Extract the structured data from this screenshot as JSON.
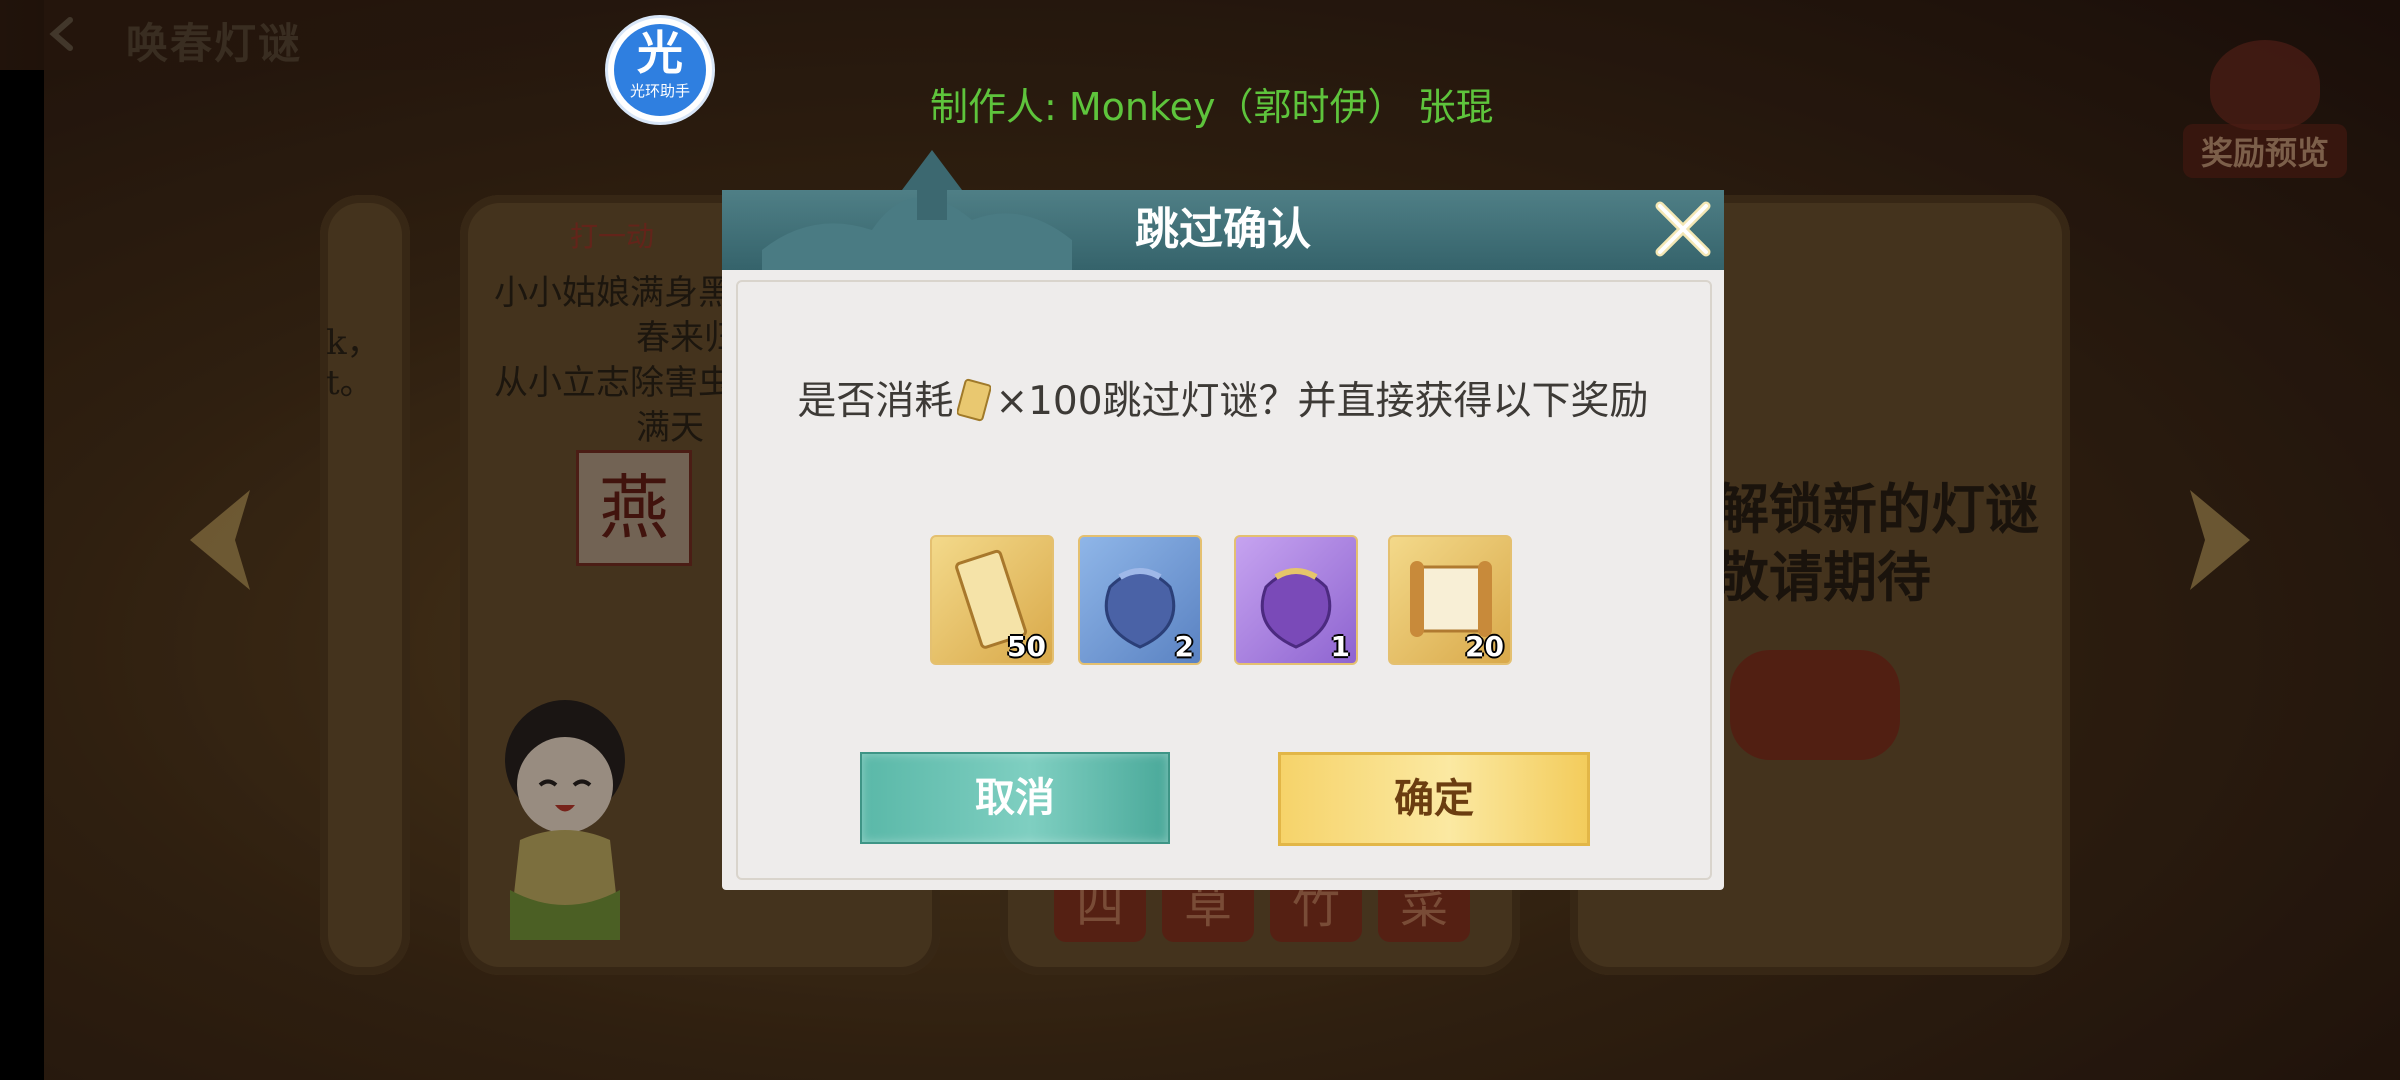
{
  "header": {
    "title": "唤春灯谜"
  },
  "helper_badge": {
    "glyph": "光",
    "label": "光环助手"
  },
  "credit": "制作人: Monkey（郭时伊） 张琨",
  "reward_preview": {
    "label": "奖励预览"
  },
  "background": {
    "card2_lines": [
      "小小姑娘满身黑",
      "春来归",
      "从小立志除害虫",
      "满天"
    ],
    "card2_tag": "打一动",
    "card1_lines": [
      "k，",
      "t。"
    ],
    "tile_char": "燕",
    "bottom_tiles": [
      "四",
      "草",
      "竹",
      "菜"
    ],
    "locked_lines": [
      "解锁新的灯谜",
      "敬请期待"
    ]
  },
  "dialog": {
    "title": "跳过确认",
    "question_prefix": "是否消耗",
    "question_suffix": "×100跳过灯谜？并直接获得以下奖励",
    "rewards": [
      {
        "icon": "ticket-icon",
        "count": "50"
      },
      {
        "icon": "blue-fortune-bag-icon",
        "count": "2"
      },
      {
        "icon": "purple-fortune-bag-icon",
        "count": "1"
      },
      {
        "icon": "scroll-icon",
        "count": "20"
      }
    ],
    "cancel_label": "取消",
    "confirm_label": "确定"
  },
  "colors": {
    "credit": "#5ec43c",
    "dialog_header": "#3f6f77",
    "cancel": "#5ab8a8",
    "confirm": "#f6d36a"
  }
}
